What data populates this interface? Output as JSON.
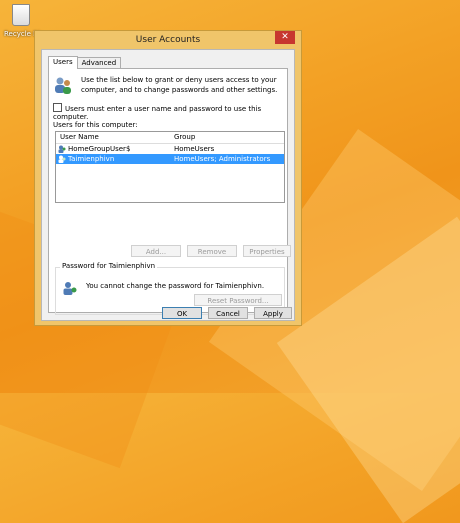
{
  "desktop": {
    "recycle_bin_label": "Recycle Bin"
  },
  "window": {
    "title": "User Accounts",
    "close_glyph": "✕"
  },
  "tabs": [
    {
      "label": "Users",
      "active": true
    },
    {
      "label": "Advanced",
      "active": false
    }
  ],
  "users_tab": {
    "intro": "Use the list below to grant or deny users access to your computer, and to change passwords and other settings.",
    "checkbox_label": "Users must enter a user name and password to use this computer.",
    "checkbox_checked": false,
    "list_label": "Users for this computer:",
    "columns": [
      "User Name",
      "Group"
    ],
    "rows": [
      {
        "name": "HomeGroupUser$",
        "group": "HomeUsers",
        "selected": false
      },
      {
        "name": "Taimienphivn",
        "group": "HomeUsers; Administrators",
        "selected": true
      }
    ],
    "buttons": {
      "add": "Add...",
      "remove": "Remove",
      "properties": "Properties"
    },
    "password_group_title": "Password for Taimienphivn",
    "password_message": "You cannot change the password for Taimienphivn.",
    "reset_password": "Reset Password..."
  },
  "footer": {
    "ok": "OK",
    "cancel": "Cancel",
    "apply": "Apply"
  },
  "colors": {
    "desktop": "#f3a125",
    "selection": "#3399ff",
    "close": "#c7372f"
  }
}
